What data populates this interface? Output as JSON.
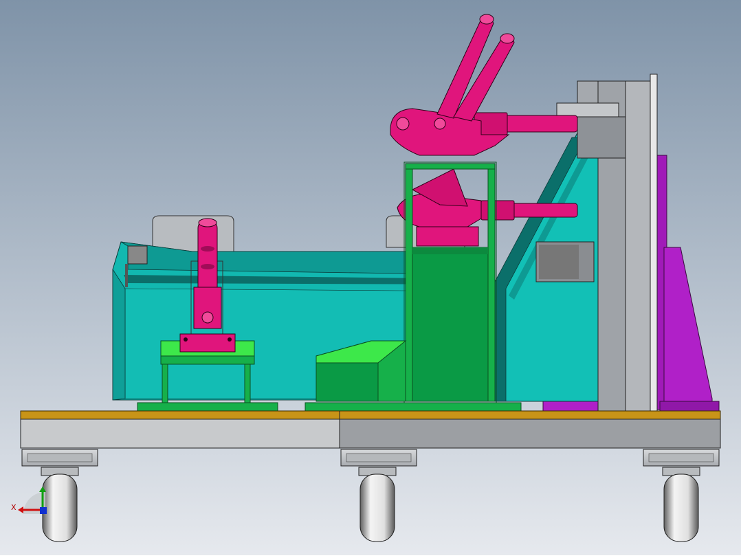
{
  "viewport": {
    "background_top": "#7f93a8",
    "background_bottom": "#e6e9ee"
  },
  "triad": {
    "axis_label": "X",
    "x_color": "#d01010",
    "y_color": "#10a010",
    "z_color": "#1030d0"
  },
  "colors": {
    "teal_body": "#12b8b0",
    "teal_dark": "#0b6f6a",
    "frame_green": "#16b04a",
    "block_green": "#0a9a45",
    "lime": "#3de84a",
    "clamp_magenta": "#e0157c",
    "plate_purple": "#b020c8",
    "steel_light": "#c8cacc",
    "steel_mid": "#9c9fa3",
    "brass_strip": "#c89418",
    "wheel_grey": "#d8d8d8"
  }
}
